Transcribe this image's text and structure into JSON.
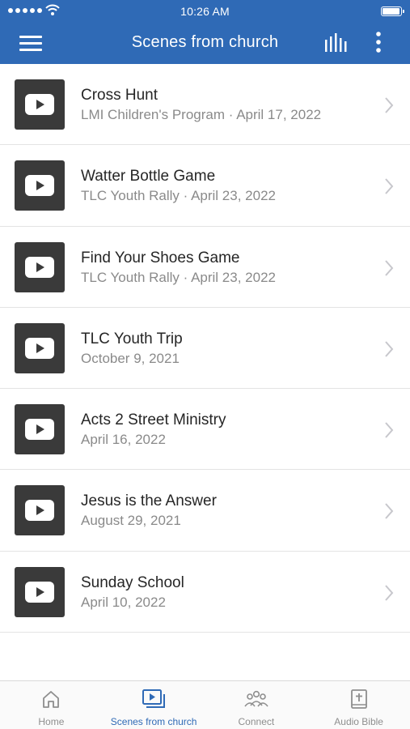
{
  "status": {
    "time": "10:26 AM"
  },
  "nav": {
    "title": "Scenes from church"
  },
  "items": [
    {
      "title": "Cross Hunt",
      "subtitle": "LMI Children's Program · April 17, 2022"
    },
    {
      "title": "Watter Bottle Game",
      "subtitle": "TLC Youth Rally · April 23, 2022"
    },
    {
      "title": "Find Your Shoes Game",
      "subtitle": "TLC Youth Rally · April 23, 2022"
    },
    {
      "title": "TLC Youth Trip",
      "subtitle": "October 9, 2021"
    },
    {
      "title": "Acts 2 Street Ministry",
      "subtitle": "April 16, 2022"
    },
    {
      "title": "Jesus is the Answer",
      "subtitle": "August 29, 2021"
    },
    {
      "title": "Sunday School",
      "subtitle": "April 10, 2022"
    }
  ],
  "tabs": [
    {
      "label": "Home",
      "icon": "home-icon"
    },
    {
      "label": "Scenes from church",
      "icon": "video-library-icon",
      "active": true
    },
    {
      "label": "Connect",
      "icon": "people-icon"
    },
    {
      "label": "Audio Bible",
      "icon": "bible-icon"
    }
  ],
  "colors": {
    "brand": "#2f6ab6",
    "thumbnail": "#3a3a3a"
  }
}
